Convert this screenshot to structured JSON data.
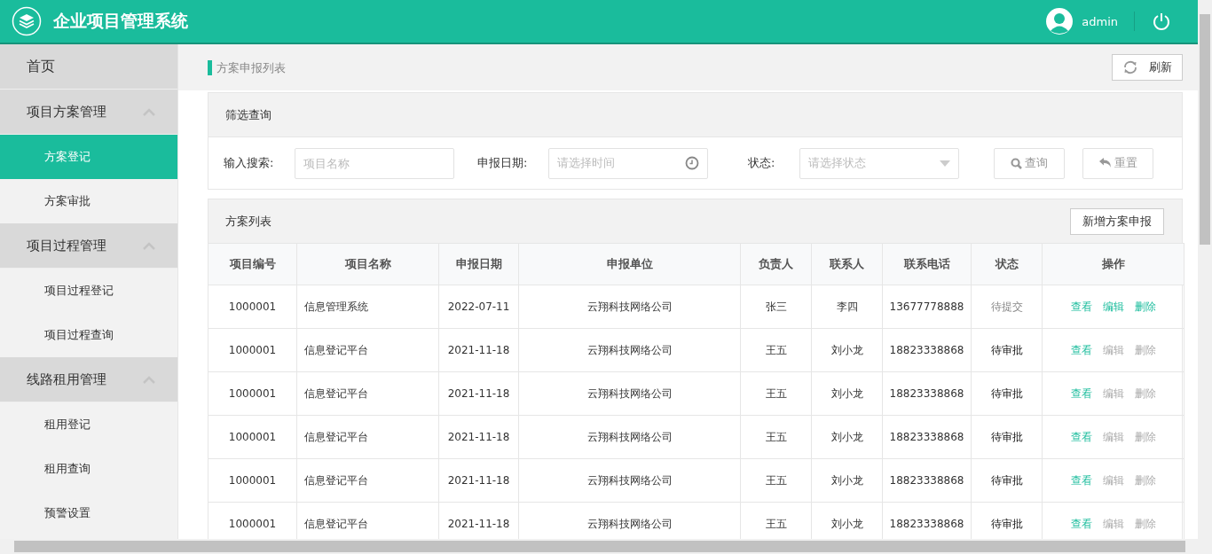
{
  "header": {
    "title": "企业项目管理系统",
    "user": "admin"
  },
  "sidebar": {
    "home": "首页",
    "groups": [
      {
        "label": "项目方案管理",
        "expanded": true,
        "items": [
          {
            "label": "方案登记",
            "selected": true
          },
          {
            "label": "方案审批",
            "selected": false
          }
        ]
      },
      {
        "label": "项目过程管理",
        "expanded": true,
        "items": [
          {
            "label": "项目过程登记",
            "selected": false
          },
          {
            "label": "项目过程查询",
            "selected": false
          }
        ]
      },
      {
        "label": "线路租用管理",
        "expanded": true,
        "items": [
          {
            "label": "租用登记",
            "selected": false
          },
          {
            "label": "租用查询",
            "selected": false
          },
          {
            "label": "预警设置",
            "selected": false
          }
        ]
      }
    ]
  },
  "breadcrumb": "方案申报列表",
  "refresh_button": "刷新",
  "filter": {
    "title": "筛选查询",
    "search_label": "输入搜索:",
    "search_placeholder": "项目名称",
    "date_label": "申报日期:",
    "date_placeholder": "请选择时间",
    "status_label": "状态:",
    "status_placeholder": "请选择状态",
    "query_button": "查询",
    "reset_button": "重置"
  },
  "list": {
    "title": "方案列表",
    "add_button": "新增方案申报",
    "columns": [
      "项目编号",
      "项目名称",
      "申报日期",
      "申报单位",
      "负责人",
      "联系人",
      "联系电话",
      "状态",
      "操作"
    ],
    "rows": [
      {
        "cells": [
          "1000001",
          "信息管理系统",
          "2022-07-11",
          "云翔科技网络公司",
          "张三",
          "李四",
          "13677778888",
          "待提交"
        ],
        "status_muted": true,
        "actions": [
          {
            "label": "查看",
            "disabled": false
          },
          {
            "label": "编辑",
            "disabled": false
          },
          {
            "label": "删除",
            "disabled": false
          }
        ]
      },
      {
        "cells": [
          "1000001",
          "信息登记平台",
          "2021-11-18",
          "云翔科技网络公司",
          "王五",
          "刘小龙",
          "18823338868",
          "待审批"
        ],
        "status_muted": false,
        "actions": [
          {
            "label": "查看",
            "disabled": false
          },
          {
            "label": "编辑",
            "disabled": true
          },
          {
            "label": "删除",
            "disabled": true
          }
        ]
      },
      {
        "cells": [
          "1000001",
          "信息登记平台",
          "2021-11-18",
          "云翔科技网络公司",
          "王五",
          "刘小龙",
          "18823338868",
          "待审批"
        ],
        "status_muted": false,
        "actions": [
          {
            "label": "查看",
            "disabled": false
          },
          {
            "label": "编辑",
            "disabled": true
          },
          {
            "label": "删除",
            "disabled": true
          }
        ]
      },
      {
        "cells": [
          "1000001",
          "信息登记平台",
          "2021-11-18",
          "云翔科技网络公司",
          "王五",
          "刘小龙",
          "18823338868",
          "待审批"
        ],
        "status_muted": false,
        "actions": [
          {
            "label": "查看",
            "disabled": false
          },
          {
            "label": "编辑",
            "disabled": true
          },
          {
            "label": "删除",
            "disabled": true
          }
        ]
      },
      {
        "cells": [
          "1000001",
          "信息登记平台",
          "2021-11-18",
          "云翔科技网络公司",
          "王五",
          "刘小龙",
          "18823338868",
          "待审批"
        ],
        "status_muted": false,
        "actions": [
          {
            "label": "查看",
            "disabled": false
          },
          {
            "label": "编辑",
            "disabled": true
          },
          {
            "label": "删除",
            "disabled": true
          }
        ]
      },
      {
        "cells": [
          "1000001",
          "信息登记平台",
          "2021-11-18",
          "云翔科技网络公司",
          "王五",
          "刘小龙",
          "18823338868",
          "待审批"
        ],
        "status_muted": false,
        "actions": [
          {
            "label": "查看",
            "disabled": false
          },
          {
            "label": "编辑",
            "disabled": true
          },
          {
            "label": "删除",
            "disabled": true
          }
        ]
      }
    ]
  }
}
